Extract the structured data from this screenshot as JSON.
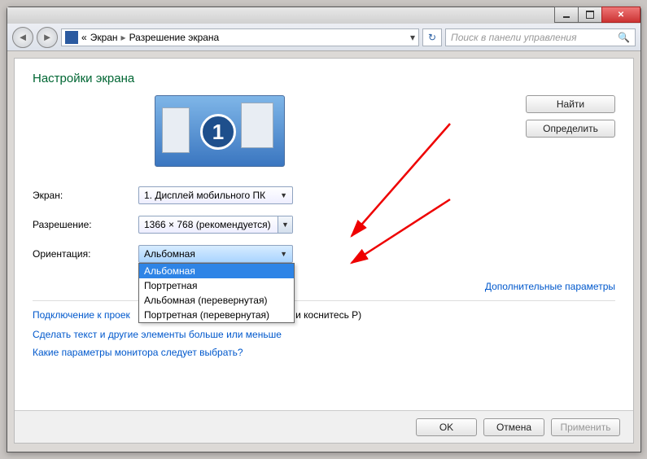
{
  "breadcrumb": {
    "prefix": "«",
    "item1": "Экран",
    "item2": "Разрешение экрана"
  },
  "search": {
    "placeholder": "Поиск в панели управления"
  },
  "heading": "Настройки экрана",
  "buttons": {
    "find": "Найти",
    "detect": "Определить",
    "ok": "OK",
    "cancel": "Отмена",
    "apply": "Применить"
  },
  "monitor_number": "1",
  "labels": {
    "screen": "Экран:",
    "resolution": "Разрешение:",
    "orientation": "Ориентация:"
  },
  "dropdowns": {
    "screen_value": "1. Дисплей мобильного ПК",
    "resolution_value": "1366 × 768 (рекомендуется)",
    "orientation_value": "Альбомная",
    "orientation_options": [
      "Альбомная",
      "Портретная",
      "Альбомная (перевернутая)",
      "Портретная (перевернутая)"
    ]
  },
  "links": {
    "advanced": "Дополнительные параметры",
    "projector": "Подключение к проек",
    "projector_suffix": "и коснитесь P)",
    "text_size": "Сделать текст и другие элементы больше или меньше",
    "which_params": "Какие параметры монитора следует выбрать?"
  }
}
